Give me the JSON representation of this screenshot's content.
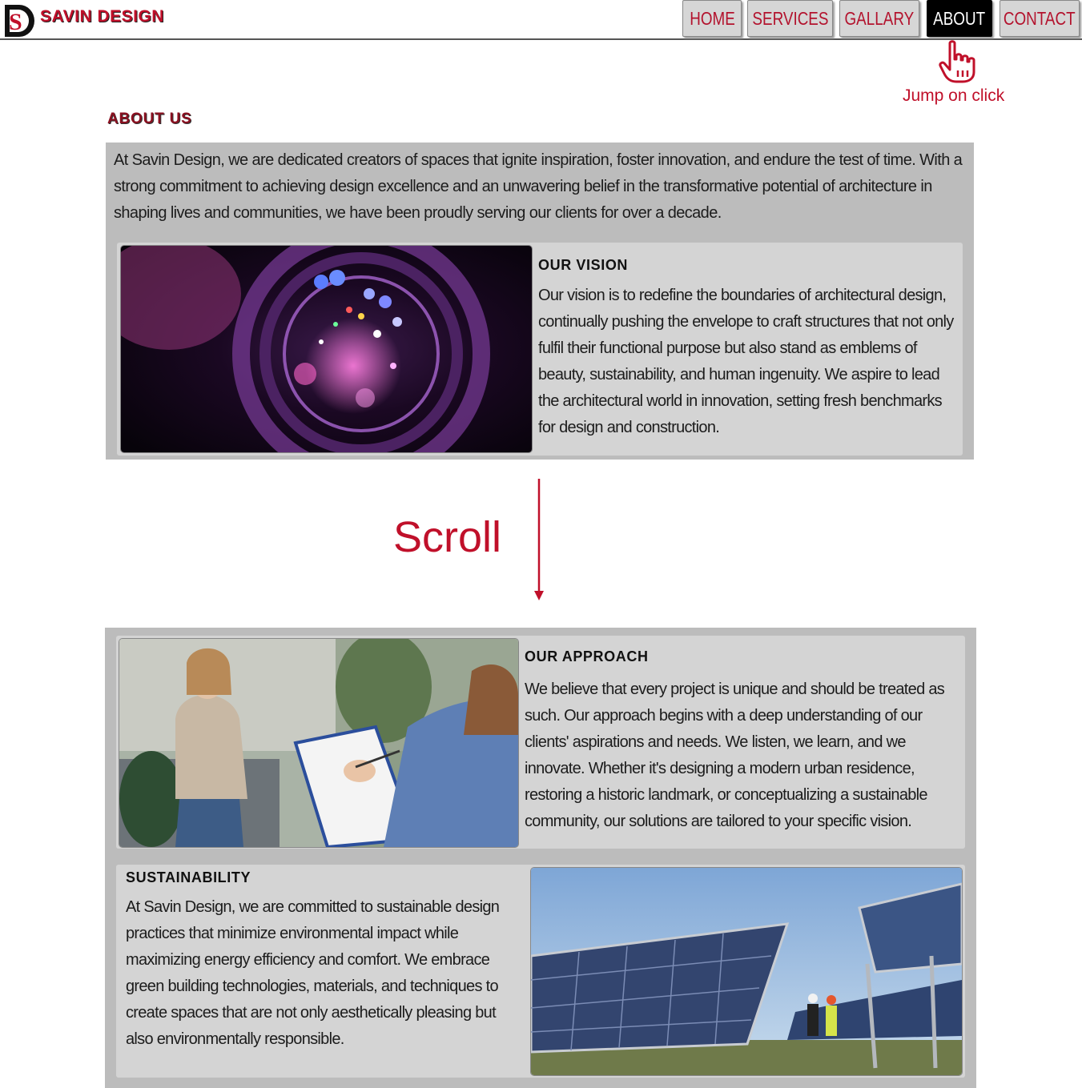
{
  "brand": {
    "name": "SAVIN DESIGN",
    "logo_letters": "S",
    "logo_icon": "sd-logo-icon"
  },
  "nav": {
    "items": [
      {
        "label": "HOME",
        "active": false
      },
      {
        "label": "SERVICES",
        "active": false
      },
      {
        "label": "GALLARY",
        "active": false
      },
      {
        "label": "ABOUT",
        "active": true
      },
      {
        "label": "CONTACT",
        "active": false
      }
    ]
  },
  "annotations": {
    "click_hint": "Jump on click",
    "click_icon": "pointer-hand-icon",
    "scroll_hint": "Scroll",
    "scroll_icon": "down-arrow-icon"
  },
  "about": {
    "title": "ABOUT US",
    "intro": "At Savin Design, we are dedicated creators of spaces that ignite inspiration, foster innovation, and endure the test of time. With a strong commitment to achieving design excellence and an unwavering belief in the transformative potential of architecture in shaping lives and communities, we have been proudly serving our clients for over a decade.",
    "vision": {
      "heading": "OUR VISION",
      "text": "Our vision is to redefine the boundaries of architectural design, continually pushing the envelope to craft structures that not only fulfil their functional purpose but also stand as emblems of beauty, sustainability, and human ingenuity. We aspire to lead the architectural world in innovation, setting fresh benchmarks for design and construction.",
      "image": "camera-lens-photo"
    },
    "approach": {
      "heading": "OUR APPROACH",
      "text": "We believe that every project is unique and should be treated as such. Our approach begins with a deep understanding of our clients' aspirations and needs. We listen, we learn, and we innovate. Whether it's designing a modern urban residence, restoring a historic landmark, or conceptualizing a sustainable community, our solutions are tailored to your specific vision.",
      "image": "client-consultation-photo"
    },
    "sustainability": {
      "heading": "SUSTAINABILITY",
      "text": "At Savin Design, we are committed to sustainable design practices that minimize environmental impact while maximizing energy efficiency and comfort. We embrace green building technologies, materials, and techniques to create spaces that are not only aesthetically pleasing but also environmentally responsible.",
      "image": "solar-panels-photo"
    }
  },
  "colors": {
    "brand_red": "#c0102a",
    "nav_bg": "#d6d6d6",
    "nav_active_bg": "#000000",
    "panel_bg": "#bcbcbc",
    "card_bg": "#d4d4d4"
  }
}
